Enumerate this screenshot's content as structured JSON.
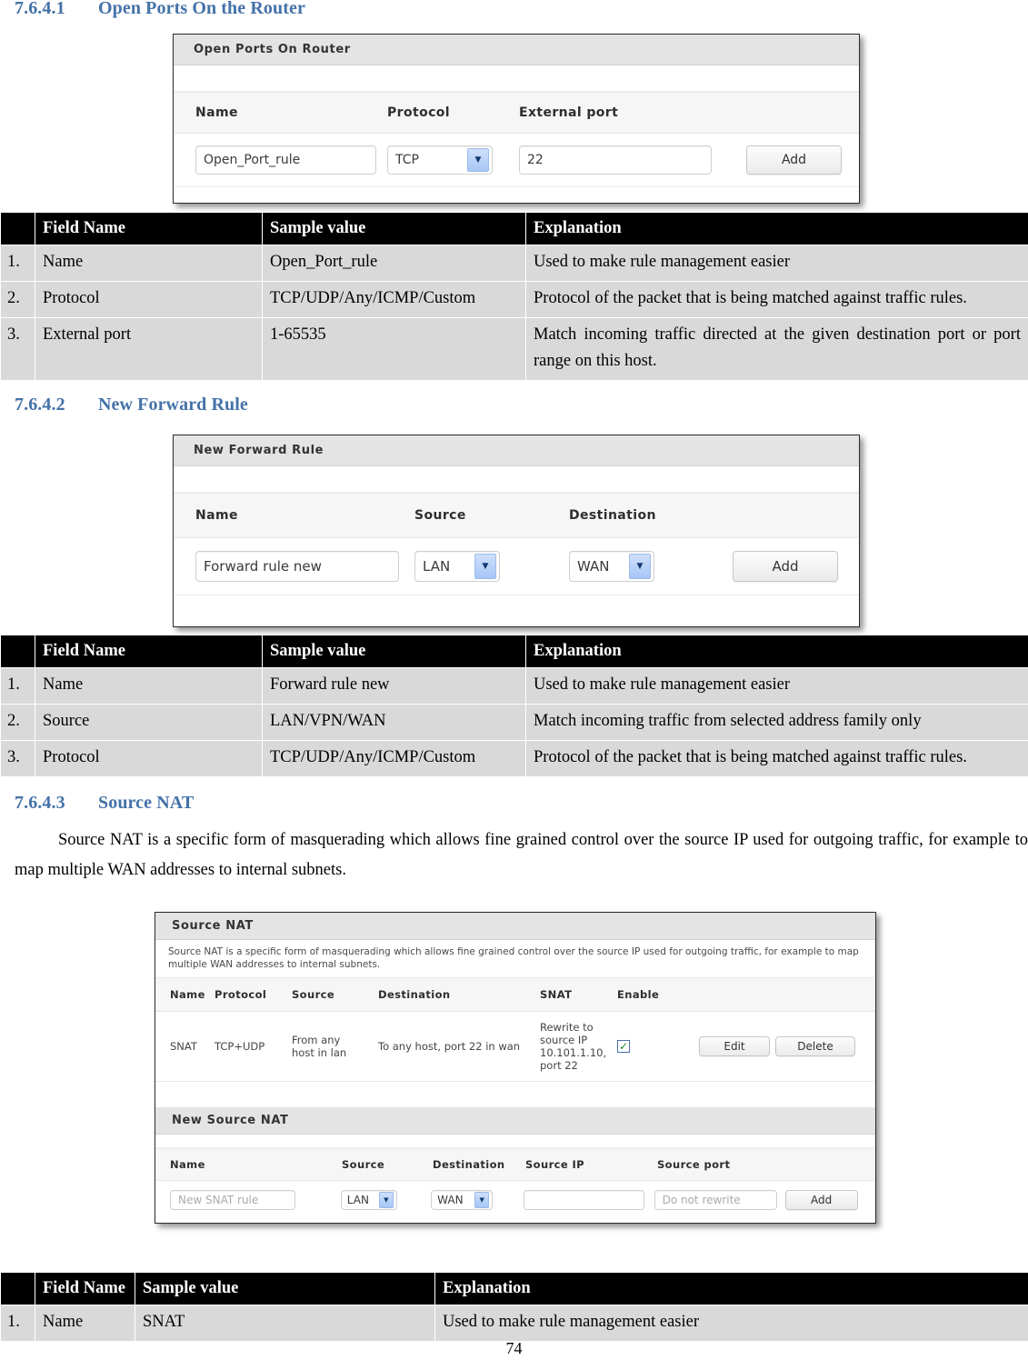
{
  "sections": {
    "s1": {
      "number": "7.6.4.1",
      "title": "Open Ports On the Router"
    },
    "s2": {
      "number": "7.6.4.2",
      "title": "New Forward Rule"
    },
    "s3": {
      "number": "7.6.4.3",
      "title": "Source NAT"
    }
  },
  "paragraphs": {
    "source_nat_intro": "Source NAT is a specific form of masquerading which allows fine grained control over the source IP used for outgoing traffic, for example to map multiple WAN addresses to internal subnets."
  },
  "screenshots": {
    "open_ports": {
      "panel_title": "Open Ports On Router",
      "columns": [
        "Name",
        "Protocol",
        "External port"
      ],
      "name_value": "Open_Port_rule",
      "protocol_value": "TCP",
      "external_port_value": "22",
      "add_label": "Add",
      "dropdown_icon": "chevron-down-icon"
    },
    "new_forward_rule": {
      "panel_title": "New Forward Rule",
      "columns": [
        "Name",
        "Source",
        "Destination"
      ],
      "name_value": "Forward rule new",
      "source_value": "LAN",
      "destination_value": "WAN",
      "add_label": "Add",
      "dropdown_icon": "chevron-down-icon"
    },
    "source_nat": {
      "panel_title": "Source NAT",
      "description": "Source NAT is a specific form of masquerading which allows fine grained control over the source IP used for outgoing traffic, for example to map multiple WAN addresses to internal subnets.",
      "columns": [
        "Name",
        "Protocol",
        "Source",
        "Destination",
        "SNAT",
        "Enable"
      ],
      "rows": [
        {
          "name": "SNAT",
          "protocol": "TCP+UDP",
          "source": "From any host in lan",
          "destination": "To any host, port 22 in wan",
          "snat": "Rewrite to source IP 10.101.1.10, port 22",
          "enabled": true,
          "edit_label": "Edit",
          "delete_label": "Delete"
        }
      ],
      "new_panel_title": "New Source NAT",
      "new_columns": [
        "Name",
        "Source",
        "Destination",
        "Source IP",
        "Source port"
      ],
      "new_name_placeholder": "New SNAT rule",
      "new_source_value": "LAN",
      "new_destination_value": "WAN",
      "new_source_ip_value": "",
      "new_source_port_placeholder": "Do not rewrite",
      "new_add_label": "Add",
      "checkbox_icon": "check-icon",
      "dropdown_icon": "chevron-down-icon"
    }
  },
  "tables": {
    "open_ports": {
      "headers": [
        "",
        "Field Name",
        "Sample value",
        "Explanation"
      ],
      "rows": [
        [
          "1.",
          "Name",
          "Open_Port_rule",
          "Used to make rule management easier"
        ],
        [
          "2.",
          "Protocol",
          "TCP/UDP/Any/ICMP/Custom",
          "Protocol of the packet that is being matched against traffic rules."
        ],
        [
          "3.",
          "External port",
          "1-65535",
          "Match incoming traffic directed at the given destination port or port range on this host."
        ]
      ]
    },
    "new_forward_rule": {
      "headers": [
        "",
        "Field Name",
        "Sample value",
        "Explanation"
      ],
      "rows": [
        [
          "1.",
          "Name",
          "Forward rule new",
          "Used to make rule management easier"
        ],
        [
          "2.",
          "Source",
          "LAN/VPN/WAN",
          "Match incoming traffic from selected address family only"
        ],
        [
          "3.",
          "Protocol",
          "TCP/UDP/Any/ICMP/Custom",
          "Protocol of the packet that is being matched against traffic rules."
        ]
      ]
    },
    "source_nat": {
      "headers": [
        "",
        "Field Name",
        "Sample value",
        "Explanation"
      ],
      "rows": [
        [
          "1.",
          "Name",
          "SNAT",
          "Used to make rule management easier"
        ]
      ]
    }
  },
  "footer": {
    "page_number": "74"
  },
  "colors": {
    "heading": "#4472a8",
    "table_header_bg": "#000000",
    "table_cell_bg": "#d9d9d9",
    "select_arrow": "#a7c6f5",
    "check": "#1f8a2f"
  }
}
